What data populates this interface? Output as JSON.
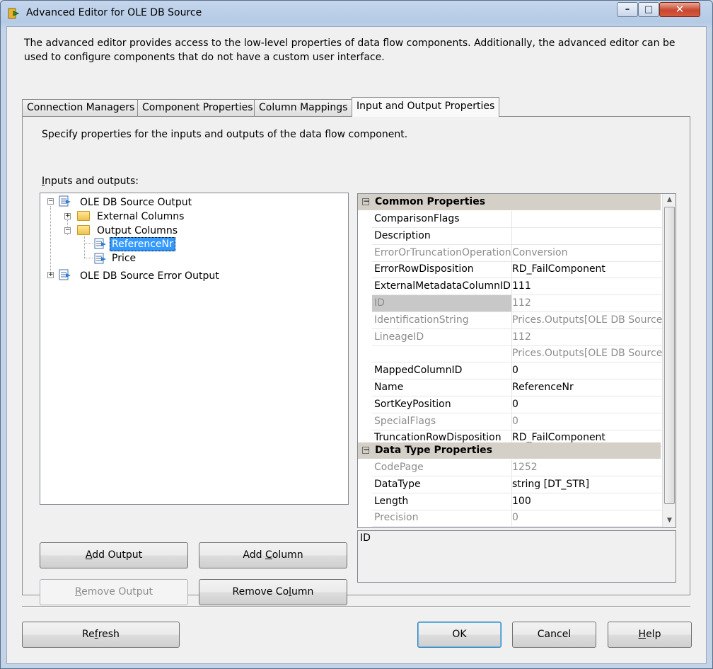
{
  "window": {
    "title": "Advanced Editor for OLE DB Source",
    "controls": {
      "minimize": "–",
      "maximize": "□",
      "close": "✕"
    }
  },
  "description": "The advanced editor provides access to the low-level properties of data flow components. Additionally, the advanced editor can be used to configure components that do not have a custom user interface.",
  "tabs": [
    {
      "label": "Connection Managers",
      "active": false
    },
    {
      "label": "Component Properties",
      "active": false
    },
    {
      "label": "Column Mappings",
      "active": false
    },
    {
      "label": "Input and Output Properties",
      "active": true
    }
  ],
  "panel": {
    "description": "Specify properties for the inputs and outputs of the data flow component.",
    "io_label_accel": "I",
    "io_label_rest": "nputs and outputs:"
  },
  "tree": {
    "source_output": "OLE DB Source Output",
    "external_columns": "External Columns",
    "output_columns": "Output Columns",
    "reference_nr": "ReferenceNr",
    "price": "Price",
    "error_output": "OLE DB Source Error Output",
    "selected": "ReferenceNr"
  },
  "buttons": {
    "add_output": {
      "pre": "",
      "accel": "A",
      "post": "dd Output"
    },
    "add_column": {
      "pre": "Add ",
      "accel": "C",
      "post": "olumn"
    },
    "remove_output": {
      "pre": "",
      "accel": "R",
      "post": "emove Output"
    },
    "remove_column": {
      "pre": "Remove Co",
      "accel": "l",
      "post": "umn"
    },
    "refresh": {
      "pre": "Re",
      "accel": "f",
      "post": "resh"
    },
    "ok": "OK",
    "cancel": "Cancel",
    "help": {
      "pre": "",
      "accel": "H",
      "post": "elp"
    }
  },
  "properties": {
    "common_category": "Common Properties",
    "common": [
      {
        "name": "ComparisonFlags",
        "value": "",
        "disabled": false
      },
      {
        "name": "Description",
        "value": "",
        "disabled": false
      },
      {
        "name": "ErrorOrTruncationOperation",
        "value": "Conversion",
        "disabled": true
      },
      {
        "name": "ErrorRowDisposition",
        "value": "RD_FailComponent",
        "disabled": false
      },
      {
        "name": "ExternalMetadataColumnID",
        "value": "111",
        "disabled": false
      },
      {
        "name": "ID",
        "value": "112",
        "disabled": true,
        "highlighted": true
      },
      {
        "name": "IdentificationString",
        "value": "Prices.Outputs[OLE DB Source",
        "disabled": true
      },
      {
        "name": "LineageID",
        "value": "112",
        "disabled": true
      },
      {
        "name": "",
        "value": "Prices.Outputs[OLE DB Source",
        "disabled": true
      },
      {
        "name": "MappedColumnID",
        "value": "0",
        "disabled": false
      },
      {
        "name": "Name",
        "value": "ReferenceNr",
        "disabled": false
      },
      {
        "name": "SortKeyPosition",
        "value": "0",
        "disabled": false
      },
      {
        "name": "SpecialFlags",
        "value": "0",
        "disabled": true
      },
      {
        "name": "TruncationRowDisposition",
        "value": "RD_FailComponent",
        "disabled": false
      }
    ],
    "datatype_category": "Data Type Properties",
    "datatype": [
      {
        "name": "CodePage",
        "value": "1252",
        "disabled": true
      },
      {
        "name": "DataType",
        "value": "string [DT_STR]",
        "disabled": false
      },
      {
        "name": "Length",
        "value": "100",
        "disabled": false
      },
      {
        "name": "Precision",
        "value": "0",
        "disabled": true
      }
    ],
    "help_text": "ID"
  }
}
